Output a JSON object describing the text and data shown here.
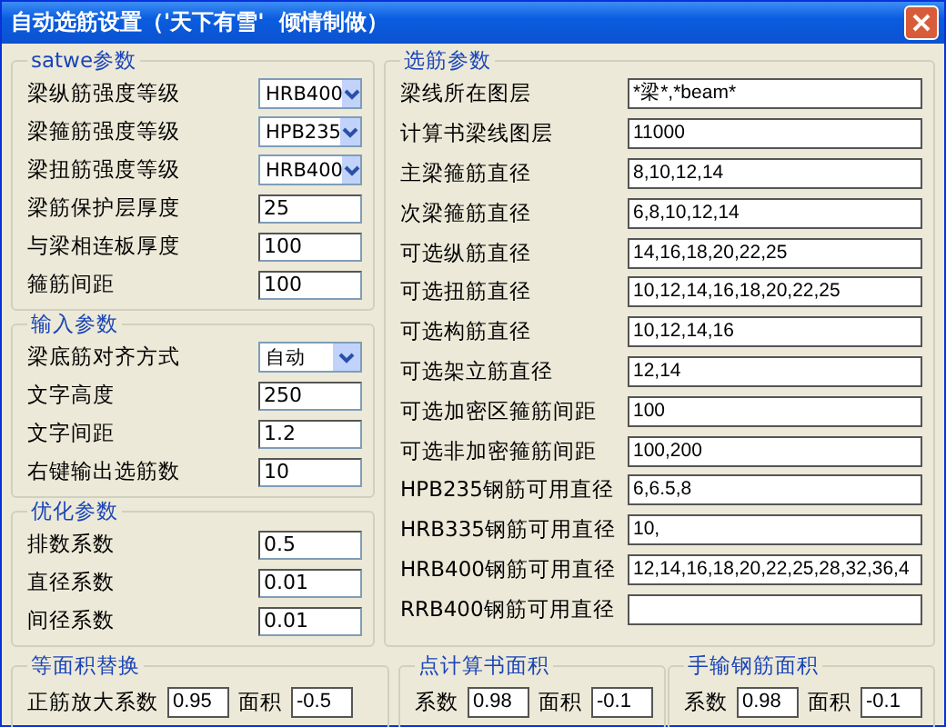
{
  "window": {
    "title": "自动选筋设置（'天下有雪'  倾情制做）"
  },
  "left_groups": [
    {
      "title": "satwe参数",
      "rows": [
        {
          "label": "梁纵筋强度等级",
          "kind": "select",
          "value": "HRB400"
        },
        {
          "label": "梁箍筋强度等级",
          "kind": "select",
          "value": "HPB235"
        },
        {
          "label": "梁扭筋强度等级",
          "kind": "select",
          "value": "HRB400"
        },
        {
          "label": "梁筋保护层厚度",
          "kind": "text",
          "value": "25"
        },
        {
          "label": "与梁相连板厚度",
          "kind": "text",
          "value": "100"
        },
        {
          "label": "箍筋间距",
          "kind": "text",
          "value": "100"
        }
      ]
    },
    {
      "title": "输入参数",
      "rows": [
        {
          "label": "梁底筋对齐方式",
          "kind": "select",
          "value": "自动"
        },
        {
          "label": "文字高度",
          "kind": "text",
          "value": "250"
        },
        {
          "label": "文字间距",
          "kind": "text",
          "value": "1.2"
        },
        {
          "label": "右键输出选筋数",
          "kind": "text",
          "value": "10"
        }
      ]
    },
    {
      "title": "优化参数",
      "rows": [
        {
          "label": "排数系数",
          "kind": "text",
          "value": "0.5"
        },
        {
          "label": "直径系数",
          "kind": "text",
          "value": "0.01"
        },
        {
          "label": "间径系数",
          "kind": "text",
          "value": "0.01"
        }
      ]
    }
  ],
  "right_group": {
    "title": "选筋参数",
    "rows": [
      {
        "label": "梁线所在图层",
        "value": "*梁*,*beam*"
      },
      {
        "label": "计算书梁线图层",
        "value": "11000"
      },
      {
        "label": "主梁箍筋直径",
        "value": "8,10,12,14"
      },
      {
        "label": "次梁箍筋直径",
        "value": "6,8,10,12,14"
      },
      {
        "label": "可选纵筋直径",
        "value": "14,16,18,20,22,25"
      },
      {
        "label": "可选扭筋直径",
        "value": "10,12,14,16,18,20,22,25"
      },
      {
        "label": "可选构筋直径",
        "value": "10,12,14,16"
      },
      {
        "label": "可选架立筋直径",
        "value": "12,14"
      },
      {
        "label": "可选加密区箍筋间距",
        "value": "100"
      },
      {
        "label": "可选非加密箍筋间距",
        "value": "100,200"
      },
      {
        "label": "HPB235钢筋可用直径",
        "value": "6,6.5,8"
      },
      {
        "label": "HRB335钢筋可用直径",
        "value": "10,"
      },
      {
        "label": "HRB400钢筋可用直径",
        "value": "12,14,16,18,20,22,25,28,32,36,4"
      },
      {
        "label": "RRB400钢筋可用直径"
      }
    ]
  },
  "bottom_groups": [
    {
      "title": "等面积替换",
      "fields": [
        {
          "label": "正筋放大系数",
          "value": "0.95"
        },
        {
          "label": "面积",
          "value": "-0.5"
        }
      ]
    },
    {
      "title": "点计算书面积",
      "fields": [
        {
          "label": "系数",
          "value": "0.98"
        },
        {
          "label": "面积",
          "value": "-0.1"
        }
      ]
    },
    {
      "title": "手输钢筋面积",
      "fields": [
        {
          "label": "系数",
          "value": "0.98"
        },
        {
          "label": "面积",
          "value": "-0.1"
        }
      ]
    }
  ]
}
